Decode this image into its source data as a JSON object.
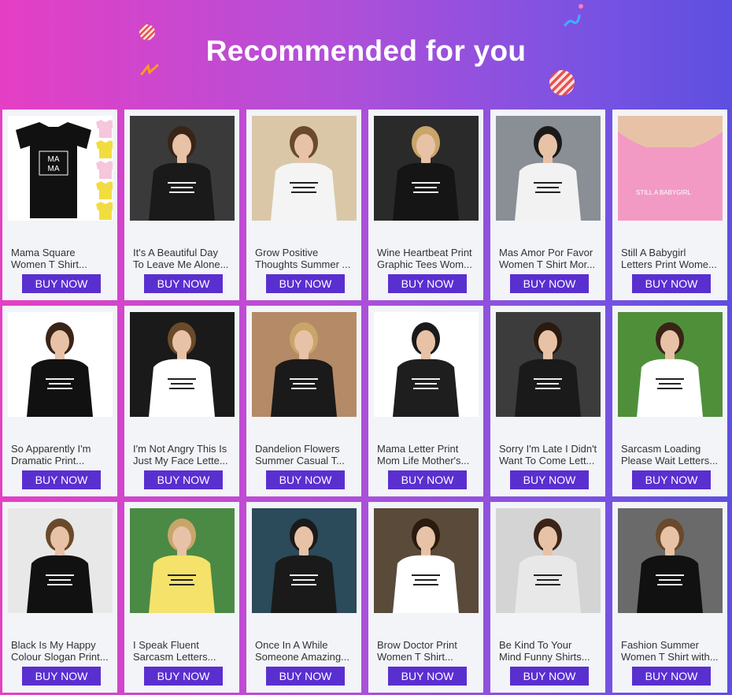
{
  "banner": {
    "title": "Recommended for you"
  },
  "colors": {
    "button": "#5a2fd0",
    "card": "#f3f4f8",
    "gradient_start": "#e53fc4",
    "gradient_end": "#5d4fe0"
  },
  "products": [
    {
      "l1": "Mama Square",
      "l2": "Women T Shirt...",
      "button": "BUY NOW",
      "shirt": "#111111",
      "bg": "#ffffff",
      "print": "MA MA"
    },
    {
      "l1": "It's A Beautiful Day",
      "l2": "To Leave Me Alone...",
      "button": "BUY NOW",
      "shirt": "#1a1a1a",
      "bg": "#3a3a3a",
      "print": ""
    },
    {
      "l1": "Grow Positive",
      "l2": "Thoughts Summer ...",
      "button": "BUY NOW",
      "shirt": "#f4f4f4",
      "bg": "#d9c7a8",
      "print": ""
    },
    {
      "l1": "Wine Heartbeat Print",
      "l2": "Graphic Tees Wom...",
      "button": "BUY NOW",
      "shirt": "#151515",
      "bg": "#2a2a2a",
      "print": ""
    },
    {
      "l1": "Mas Amor Por Favor",
      "l2": "Women T Shirt Mor...",
      "button": "BUY NOW",
      "shirt": "#f2f2f2",
      "bg": "#8a8f96",
      "print": ""
    },
    {
      "l1": "Still A Babygirl",
      "l2": "Letters Print Wome...",
      "button": "BUY NOW",
      "shirt": "#f29ac4",
      "bg": "#f29ac4",
      "print": "STILL A BABYGIRL"
    },
    {
      "l1": "So Apparently I'm",
      "l2": "Dramatic Print...",
      "button": "BUY NOW",
      "shirt": "#111111",
      "bg": "#ffffff",
      "print": ""
    },
    {
      "l1": "I'm Not Angry This Is",
      "l2": "Just My Face Lette...",
      "button": "BUY NOW",
      "shirt": "#ffffff",
      "bg": "#1a1a1a",
      "print": ""
    },
    {
      "l1": "Dandelion Flowers",
      "l2": "Summer Casual T...",
      "button": "BUY NOW",
      "shirt": "#1a1a1a",
      "bg": "#b58a66",
      "print": ""
    },
    {
      "l1": "Mama Letter Print",
      "l2": "Mom Life Mother's...",
      "button": "BUY NOW",
      "shirt": "#1e1e1e",
      "bg": "#ffffff",
      "print": ""
    },
    {
      "l1": "Sorry I'm Late I Didn't",
      "l2": "Want To Come Lett...",
      "button": "BUY NOW",
      "shirt": "#1a1a1a",
      "bg": "#3c3c3c",
      "print": ""
    },
    {
      "l1": "Sarcasm Loading",
      "l2": "Please Wait Letters...",
      "button": "BUY NOW",
      "shirt": "#ffffff",
      "bg": "#4f8f3a",
      "print": ""
    },
    {
      "l1": "Black Is My Happy",
      "l2": "Colour Slogan Print...",
      "button": "BUY NOW",
      "shirt": "#111111",
      "bg": "#e8e8e8",
      "print": ""
    },
    {
      "l1": "I Speak Fluent",
      "l2": "Sarcasm Letters...",
      "button": "BUY NOW",
      "shirt": "#f5e26a",
      "bg": "#4a8a44",
      "print": ""
    },
    {
      "l1": "Once In A While",
      "l2": "Someone Amazing...",
      "button": "BUY NOW",
      "shirt": "#1a1a1a",
      "bg": "#2b4a5a",
      "print": ""
    },
    {
      "l1": "Brow Doctor Print",
      "l2": "Women T Shirt...",
      "button": "BUY NOW",
      "shirt": "#ffffff",
      "bg": "#5a4a3a",
      "print": ""
    },
    {
      "l1": "Be Kind To Your",
      "l2": "Mind Funny Shirts...",
      "button": "BUY NOW",
      "shirt": "#e8e8e8",
      "bg": "#d4d4d4",
      "print": ""
    },
    {
      "l1": "Fashion Summer",
      "l2": "Women T Shirt with...",
      "button": "BUY NOW",
      "shirt": "#111111",
      "bg": "#6a6a6a",
      "print": ""
    }
  ]
}
